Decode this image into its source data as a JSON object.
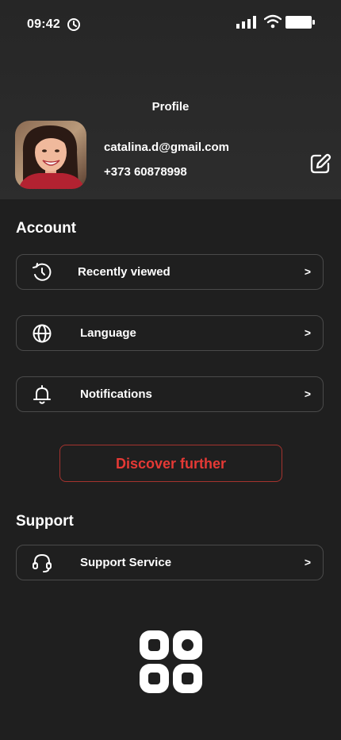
{
  "status_bar": {
    "time": "09:42",
    "icons": [
      "clock-icon",
      "cellular-signal-icon",
      "wifi-icon",
      "battery-icon"
    ]
  },
  "profile": {
    "title": "Profile",
    "email": "catalina.d@gmail.com",
    "phone": "+373 60878998",
    "edit_icon": "edit-icon"
  },
  "account": {
    "title": "Account",
    "items": [
      {
        "label": "Recently viewed",
        "icon": "history-icon",
        "chevron": ">"
      },
      {
        "label": "Language",
        "icon": "globe-icon",
        "chevron": ">"
      },
      {
        "label": "Notifications",
        "icon": "bell-icon",
        "chevron": ">"
      }
    ]
  },
  "discover_label": "Discover further",
  "support": {
    "title": "Support",
    "items": [
      {
        "label": "Support Service",
        "icon": "headset-icon",
        "chevron": ">"
      }
    ]
  },
  "footer": {
    "icon": "app-grid-logo-icon"
  },
  "colors": {
    "background": "#1f1f1f",
    "header": "#2a2a2a",
    "accent": "#e53935",
    "border": "#4a4a4a",
    "text": "#ffffff"
  }
}
